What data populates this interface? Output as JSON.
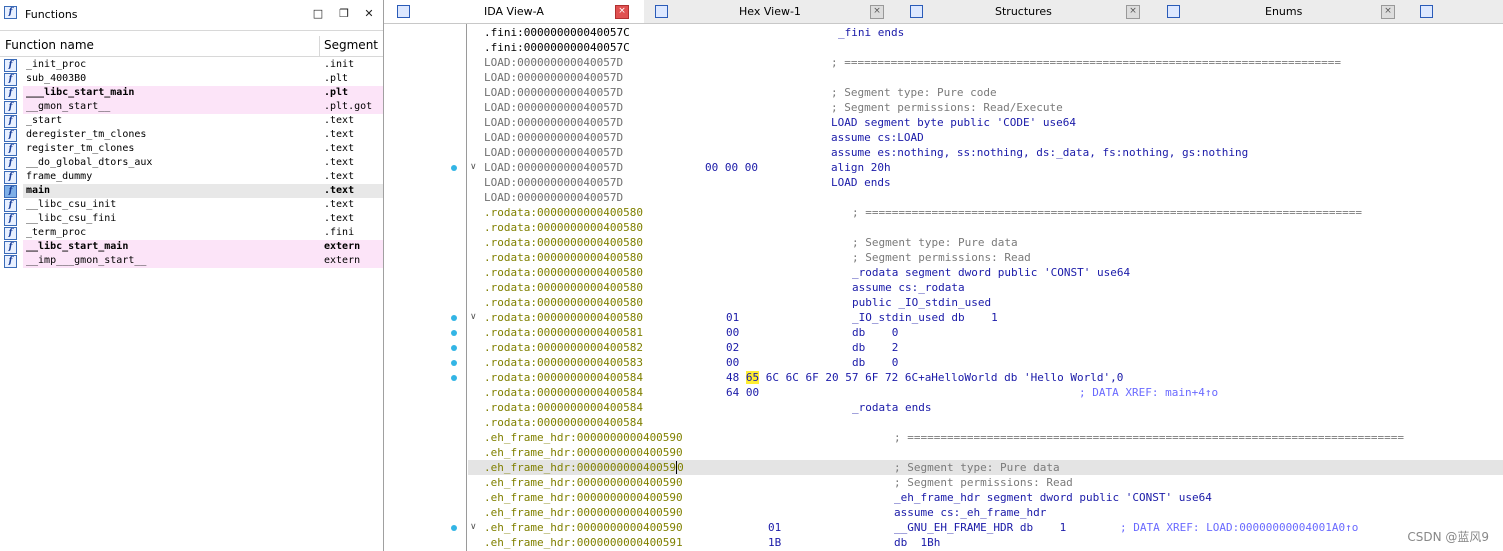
{
  "functions_panel": {
    "title": "Functions",
    "col_name": "Function name",
    "col_segment": "Segment",
    "rows": [
      {
        "name": "_init_proc",
        "segment": ".init",
        "style": ""
      },
      {
        "name": "sub_4003B0",
        "segment": ".plt",
        "style": ""
      },
      {
        "name": "___libc_start_main",
        "segment": ".plt",
        "style": "pink bold"
      },
      {
        "name": "__gmon_start__",
        "segment": ".plt.got",
        "style": "pink"
      },
      {
        "name": "_start",
        "segment": ".text",
        "style": ""
      },
      {
        "name": "deregister_tm_clones",
        "segment": ".text",
        "style": ""
      },
      {
        "name": "register_tm_clones",
        "segment": ".text",
        "style": ""
      },
      {
        "name": "__do_global_dtors_aux",
        "segment": ".text",
        "style": ""
      },
      {
        "name": "frame_dummy",
        "segment": ".text",
        "style": ""
      },
      {
        "name": "main",
        "segment": ".text",
        "style": "sel bold"
      },
      {
        "name": "__libc_csu_init",
        "segment": ".text",
        "style": ""
      },
      {
        "name": "__libc_csu_fini",
        "segment": ".text",
        "style": ""
      },
      {
        "name": "_term_proc",
        "segment": ".fini",
        "style": ""
      },
      {
        "name": "__libc_start_main",
        "segment": "extern",
        "style": "pink bold"
      },
      {
        "name": "__imp___gmon_start__",
        "segment": "extern",
        "style": "pink"
      }
    ]
  },
  "tabs": [
    {
      "label": "IDA View-A",
      "active": true
    },
    {
      "label": "Hex View-1",
      "active": false
    },
    {
      "label": "Structures",
      "active": false
    },
    {
      "label": "Enums",
      "active": false
    }
  ],
  "colors": {
    "fini": "#000000",
    "load": "#707070",
    "rodata": "#808000",
    "eh": "#808000"
  },
  "code_lines": [
    {
      "seg": ".fini:000000000040057C",
      "segkey": "fini",
      "bytes": "",
      "instr": "_fini ends",
      "comment": "",
      "xref": ""
    },
    {
      "seg": ".fini:000000000040057C",
      "segkey": "fini",
      "bytes": "",
      "instr": "",
      "comment": "",
      "xref": ""
    },
    {
      "seg": "LOAD:000000000040057D",
      "segkey": "load",
      "bytes": "",
      "instr": "",
      "comment": "; ===========================================================================",
      "xref": ""
    },
    {
      "seg": "LOAD:000000000040057D",
      "segkey": "load",
      "bytes": "",
      "instr": "",
      "comment": "",
      "xref": ""
    },
    {
      "seg": "LOAD:000000000040057D",
      "segkey": "load",
      "bytes": "",
      "instr": "",
      "comment": "; Segment type: Pure code",
      "xref": ""
    },
    {
      "seg": "LOAD:000000000040057D",
      "segkey": "load",
      "bytes": "",
      "instr": "",
      "comment": "; Segment permissions: Read/Execute",
      "xref": ""
    },
    {
      "seg": "LOAD:000000000040057D",
      "segkey": "load",
      "bytes": "",
      "instr": "LOAD segment byte public 'CODE' use64",
      "comment": "",
      "xref": ""
    },
    {
      "seg": "LOAD:000000000040057D",
      "segkey": "load",
      "bytes": "",
      "instr": "assume cs:LOAD",
      "comment": "",
      "xref": ""
    },
    {
      "seg": "LOAD:000000000040057D",
      "segkey": "load",
      "bytes": "",
      "instr": "assume es:nothing, ss:nothing, ds:_data, fs:nothing, gs:nothing",
      "comment": "",
      "xref": ""
    },
    {
      "seg": "LOAD:000000000040057D",
      "segkey": "load",
      "bytes": "00 00 00",
      "instr": "align 20h",
      "comment": "",
      "xref": ""
    },
    {
      "seg": "LOAD:000000000040057D",
      "segkey": "load",
      "bytes": "",
      "instr": "LOAD ends",
      "comment": "",
      "xref": ""
    },
    {
      "seg": "LOAD:000000000040057D",
      "segkey": "load",
      "bytes": "",
      "instr": "",
      "comment": "",
      "xref": ""
    },
    {
      "seg": ".rodata:0000000000400580",
      "segkey": "rodata",
      "bytes": "",
      "instr": "",
      "comment": "; ===========================================================================",
      "xref": ""
    },
    {
      "seg": ".rodata:0000000000400580",
      "segkey": "rodata",
      "bytes": "",
      "instr": "",
      "comment": "",
      "xref": ""
    },
    {
      "seg": ".rodata:0000000000400580",
      "segkey": "rodata",
      "bytes": "",
      "instr": "",
      "comment": "; Segment type: Pure data",
      "xref": ""
    },
    {
      "seg": ".rodata:0000000000400580",
      "segkey": "rodata",
      "bytes": "",
      "instr": "",
      "comment": "; Segment permissions: Read",
      "xref": ""
    },
    {
      "seg": ".rodata:0000000000400580",
      "segkey": "rodata",
      "bytes": "",
      "instr": "_rodata segment dword public 'CONST' use64",
      "comment": "",
      "xref": ""
    },
    {
      "seg": ".rodata:0000000000400580",
      "segkey": "rodata",
      "bytes": "",
      "instr": "assume cs:_rodata",
      "comment": "",
      "xref": ""
    },
    {
      "seg": ".rodata:0000000000400580",
      "segkey": "rodata",
      "bytes": "",
      "instr": "public _IO_stdin_used",
      "comment": "",
      "xref": ""
    },
    {
      "seg": ".rodata:0000000000400580",
      "segkey": "rodata",
      "bytes": "01",
      "instr": "_IO_stdin_used db    1",
      "comment": "",
      "xref": ""
    },
    {
      "seg": ".rodata:0000000000400581",
      "segkey": "rodata",
      "bytes": "00",
      "instr": "db    0",
      "comment": "",
      "xref": ""
    },
    {
      "seg": ".rodata:0000000000400582",
      "segkey": "rodata",
      "bytes": "02",
      "instr": "db    2",
      "comment": "",
      "xref": ""
    },
    {
      "seg": ".rodata:0000000000400583",
      "segkey": "rodata",
      "bytes": "00",
      "instr": "db    0",
      "comment": "",
      "xref": ""
    },
    {
      "seg": ".rodata:0000000000400584",
      "segkey": "rodata",
      "bytes": "48 65 6C 6C 6F 20 57 6F 72 6C+aHelloWorld db 'Hello World',0",
      "instr": "",
      "comment": "",
      "xref": ""
    },
    {
      "seg": ".rodata:0000000000400584",
      "segkey": "rodata",
      "bytes": "64 00",
      "instr": "",
      "comment": "",
      "xref": "; DATA XREF: main+4↑o"
    },
    {
      "seg": ".rodata:0000000000400584",
      "segkey": "rodata",
      "bytes": "",
      "instr": "_rodata ends",
      "comment": "",
      "xref": ""
    },
    {
      "seg": ".rodata:0000000000400584",
      "segkey": "rodata",
      "bytes": "",
      "instr": "",
      "comment": "",
      "xref": ""
    },
    {
      "seg": ".eh_frame_hdr:0000000000400590",
      "segkey": "eh",
      "bytes": "",
      "instr": "",
      "comment": "; ===========================================================================",
      "xref": ""
    },
    {
      "seg": ".eh_frame_hdr:0000000000400590",
      "segkey": "eh",
      "bytes": "",
      "instr": "",
      "comment": "",
      "xref": ""
    },
    {
      "seg": ".eh_frame_hdr:0000000000400590",
      "segkey": "eh",
      "bytes": "",
      "instr": "",
      "comment": "; Segment type: Pure data",
      "xref": ""
    },
    {
      "seg": ".eh_frame_hdr:0000000000400590",
      "segkey": "eh",
      "bytes": "",
      "instr": "",
      "comment": "; Segment permissions: Read",
      "xref": ""
    },
    {
      "seg": ".eh_frame_hdr:0000000000400590",
      "segkey": "eh",
      "bytes": "",
      "instr": "_eh_frame_hdr segment dword public 'CONST' use64",
      "comment": "",
      "xref": ""
    },
    {
      "seg": ".eh_frame_hdr:0000000000400590",
      "segkey": "eh",
      "bytes": "",
      "instr": "assume cs:_eh_frame_hdr",
      "comment": "",
      "xref": ""
    },
    {
      "seg": ".eh_frame_hdr:0000000000400590",
      "segkey": "eh",
      "bytes": "01",
      "instr": "__GNU_EH_FRAME_HDR db    1",
      "comment": "",
      "xref": "; DATA XREF: LOAD:00000000004001A0↑o"
    },
    {
      "seg": ".eh_frame_hdr:0000000000400591",
      "segkey": "eh",
      "bytes": "1B",
      "instr": "db  1Bh",
      "comment": "",
      "xref": ""
    }
  ],
  "watermark": "CSDN @蓝风9"
}
